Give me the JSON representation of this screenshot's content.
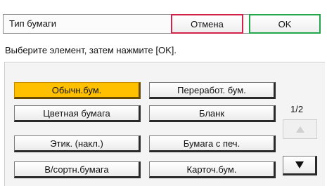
{
  "header": {
    "title": "Тип бумаги",
    "cancel_label": "Отмена",
    "ok_label": "OK"
  },
  "instruction": "Выберите элемент, затем нажмите [OK].",
  "options": [
    {
      "label": "Обычн.бум.",
      "selected": true
    },
    {
      "label": "Переработ. бум.",
      "selected": false
    },
    {
      "label": "Цветная бумага",
      "selected": false
    },
    {
      "label": "Бланк",
      "selected": false
    },
    {
      "label": "Этик. (накл.)",
      "selected": false
    },
    {
      "label": "Бумага с печ.",
      "selected": false
    },
    {
      "label": "В/сортн.бумага",
      "selected": false
    },
    {
      "label": "Карточ.бум.",
      "selected": false
    }
  ],
  "pager": {
    "text": "1/2",
    "up_icon": "arrow-up-icon",
    "down_icon": "arrow-down-icon"
  },
  "colors": {
    "selected": "#ffc000",
    "cancel_border": "#d2224a",
    "ok_border": "#22a84a"
  }
}
